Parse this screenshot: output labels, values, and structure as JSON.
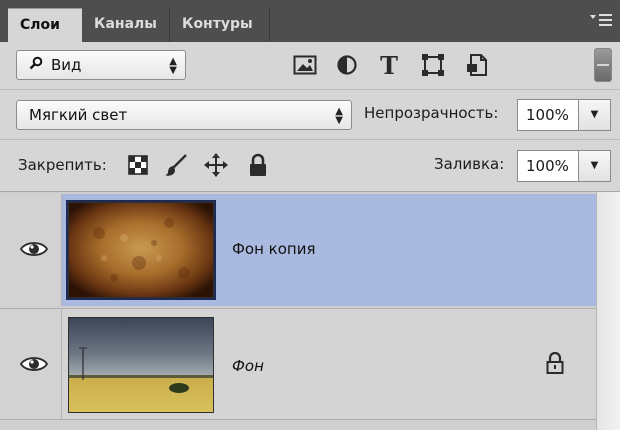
{
  "tabs": [
    {
      "label": "Слои"
    },
    {
      "label": "Каналы"
    },
    {
      "label": "Контуры"
    }
  ],
  "filter": {
    "kind_label": "Вид",
    "icons": [
      "image-filter-icon",
      "adjustment-filter-icon",
      "type-filter-icon",
      "shape-filter-icon",
      "smart-object-filter-icon"
    ]
  },
  "blend": {
    "mode": "Мягкий свет",
    "opacity_label": "Непрозрачность:",
    "opacity_value": "100%"
  },
  "lock": {
    "label": "Закрепить:",
    "fill_label": "Заливка:",
    "fill_value": "100%"
  },
  "layers": [
    {
      "name": "Фон копия",
      "selected": true,
      "visible": true,
      "locked": false
    },
    {
      "name": "Фон",
      "selected": false,
      "visible": true,
      "locked": true
    }
  ],
  "colors": {
    "tab_bar": "#4e4e4e",
    "panel": "#d6d6d6",
    "selected_layer": "#a9b9df"
  }
}
